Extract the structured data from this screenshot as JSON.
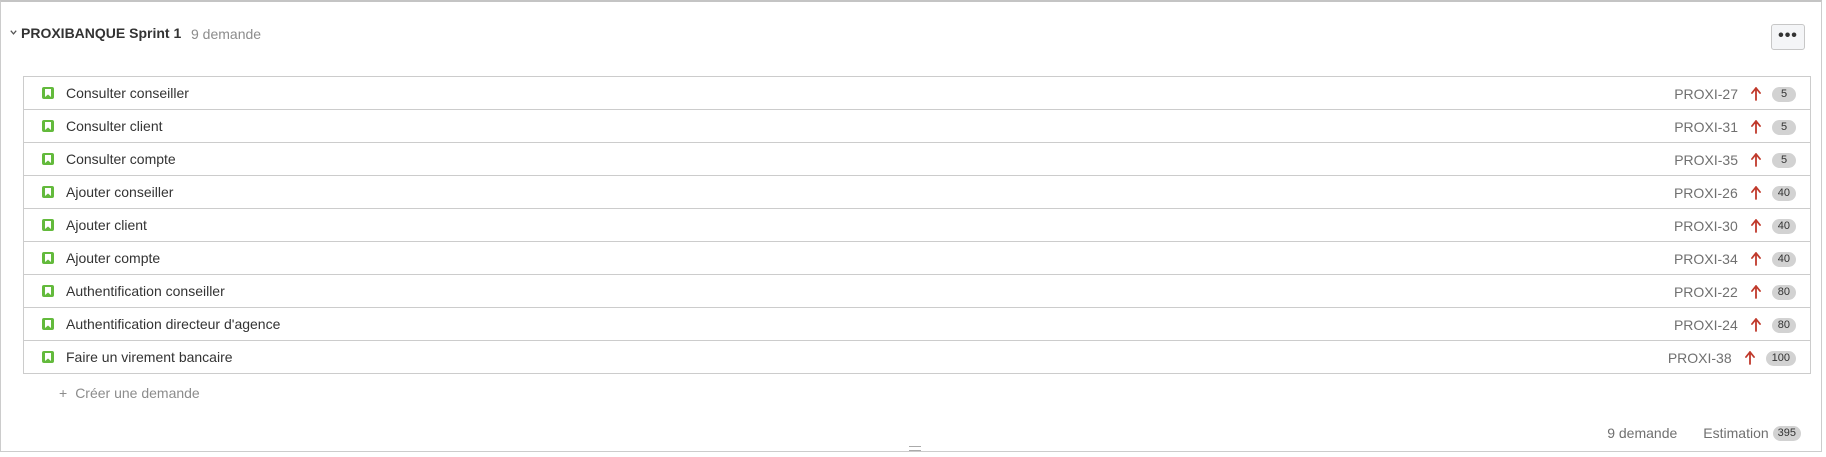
{
  "sprint": {
    "name": "PROXIBANQUE Sprint 1",
    "issue_count": "9 demande",
    "more_label": "•••"
  },
  "issues": [
    {
      "summary": "Consulter conseiller",
      "key": "PROXI-27",
      "estimate": "5"
    },
    {
      "summary": "Consulter client",
      "key": "PROXI-31",
      "estimate": "5"
    },
    {
      "summary": "Consulter compte",
      "key": "PROXI-35",
      "estimate": "5"
    },
    {
      "summary": "Ajouter conseiller",
      "key": "PROXI-26",
      "estimate": "40"
    },
    {
      "summary": "Ajouter client",
      "key": "PROXI-30",
      "estimate": "40"
    },
    {
      "summary": "Ajouter compte",
      "key": "PROXI-34",
      "estimate": "40"
    },
    {
      "summary": "Authentification conseiller",
      "key": "PROXI-22",
      "estimate": "80"
    },
    {
      "summary": "Authentification directeur d'agence",
      "key": "PROXI-24",
      "estimate": "80"
    },
    {
      "summary": "Faire un virement bancaire",
      "key": "PROXI-38",
      "estimate": "100"
    }
  ],
  "create_issue": {
    "plus": "+",
    "label": "Créer une demande"
  },
  "footer": {
    "count": "9 demande",
    "estimate_label": "Estimation",
    "estimate_total": "395"
  },
  "icons": {
    "issue_type": "story-bookmark-icon",
    "priority": "priority-high-arrow-icon",
    "chevron": "chevron-down-icon"
  },
  "colors": {
    "story": "#63ba3c",
    "priority_high": "#c0392b"
  }
}
